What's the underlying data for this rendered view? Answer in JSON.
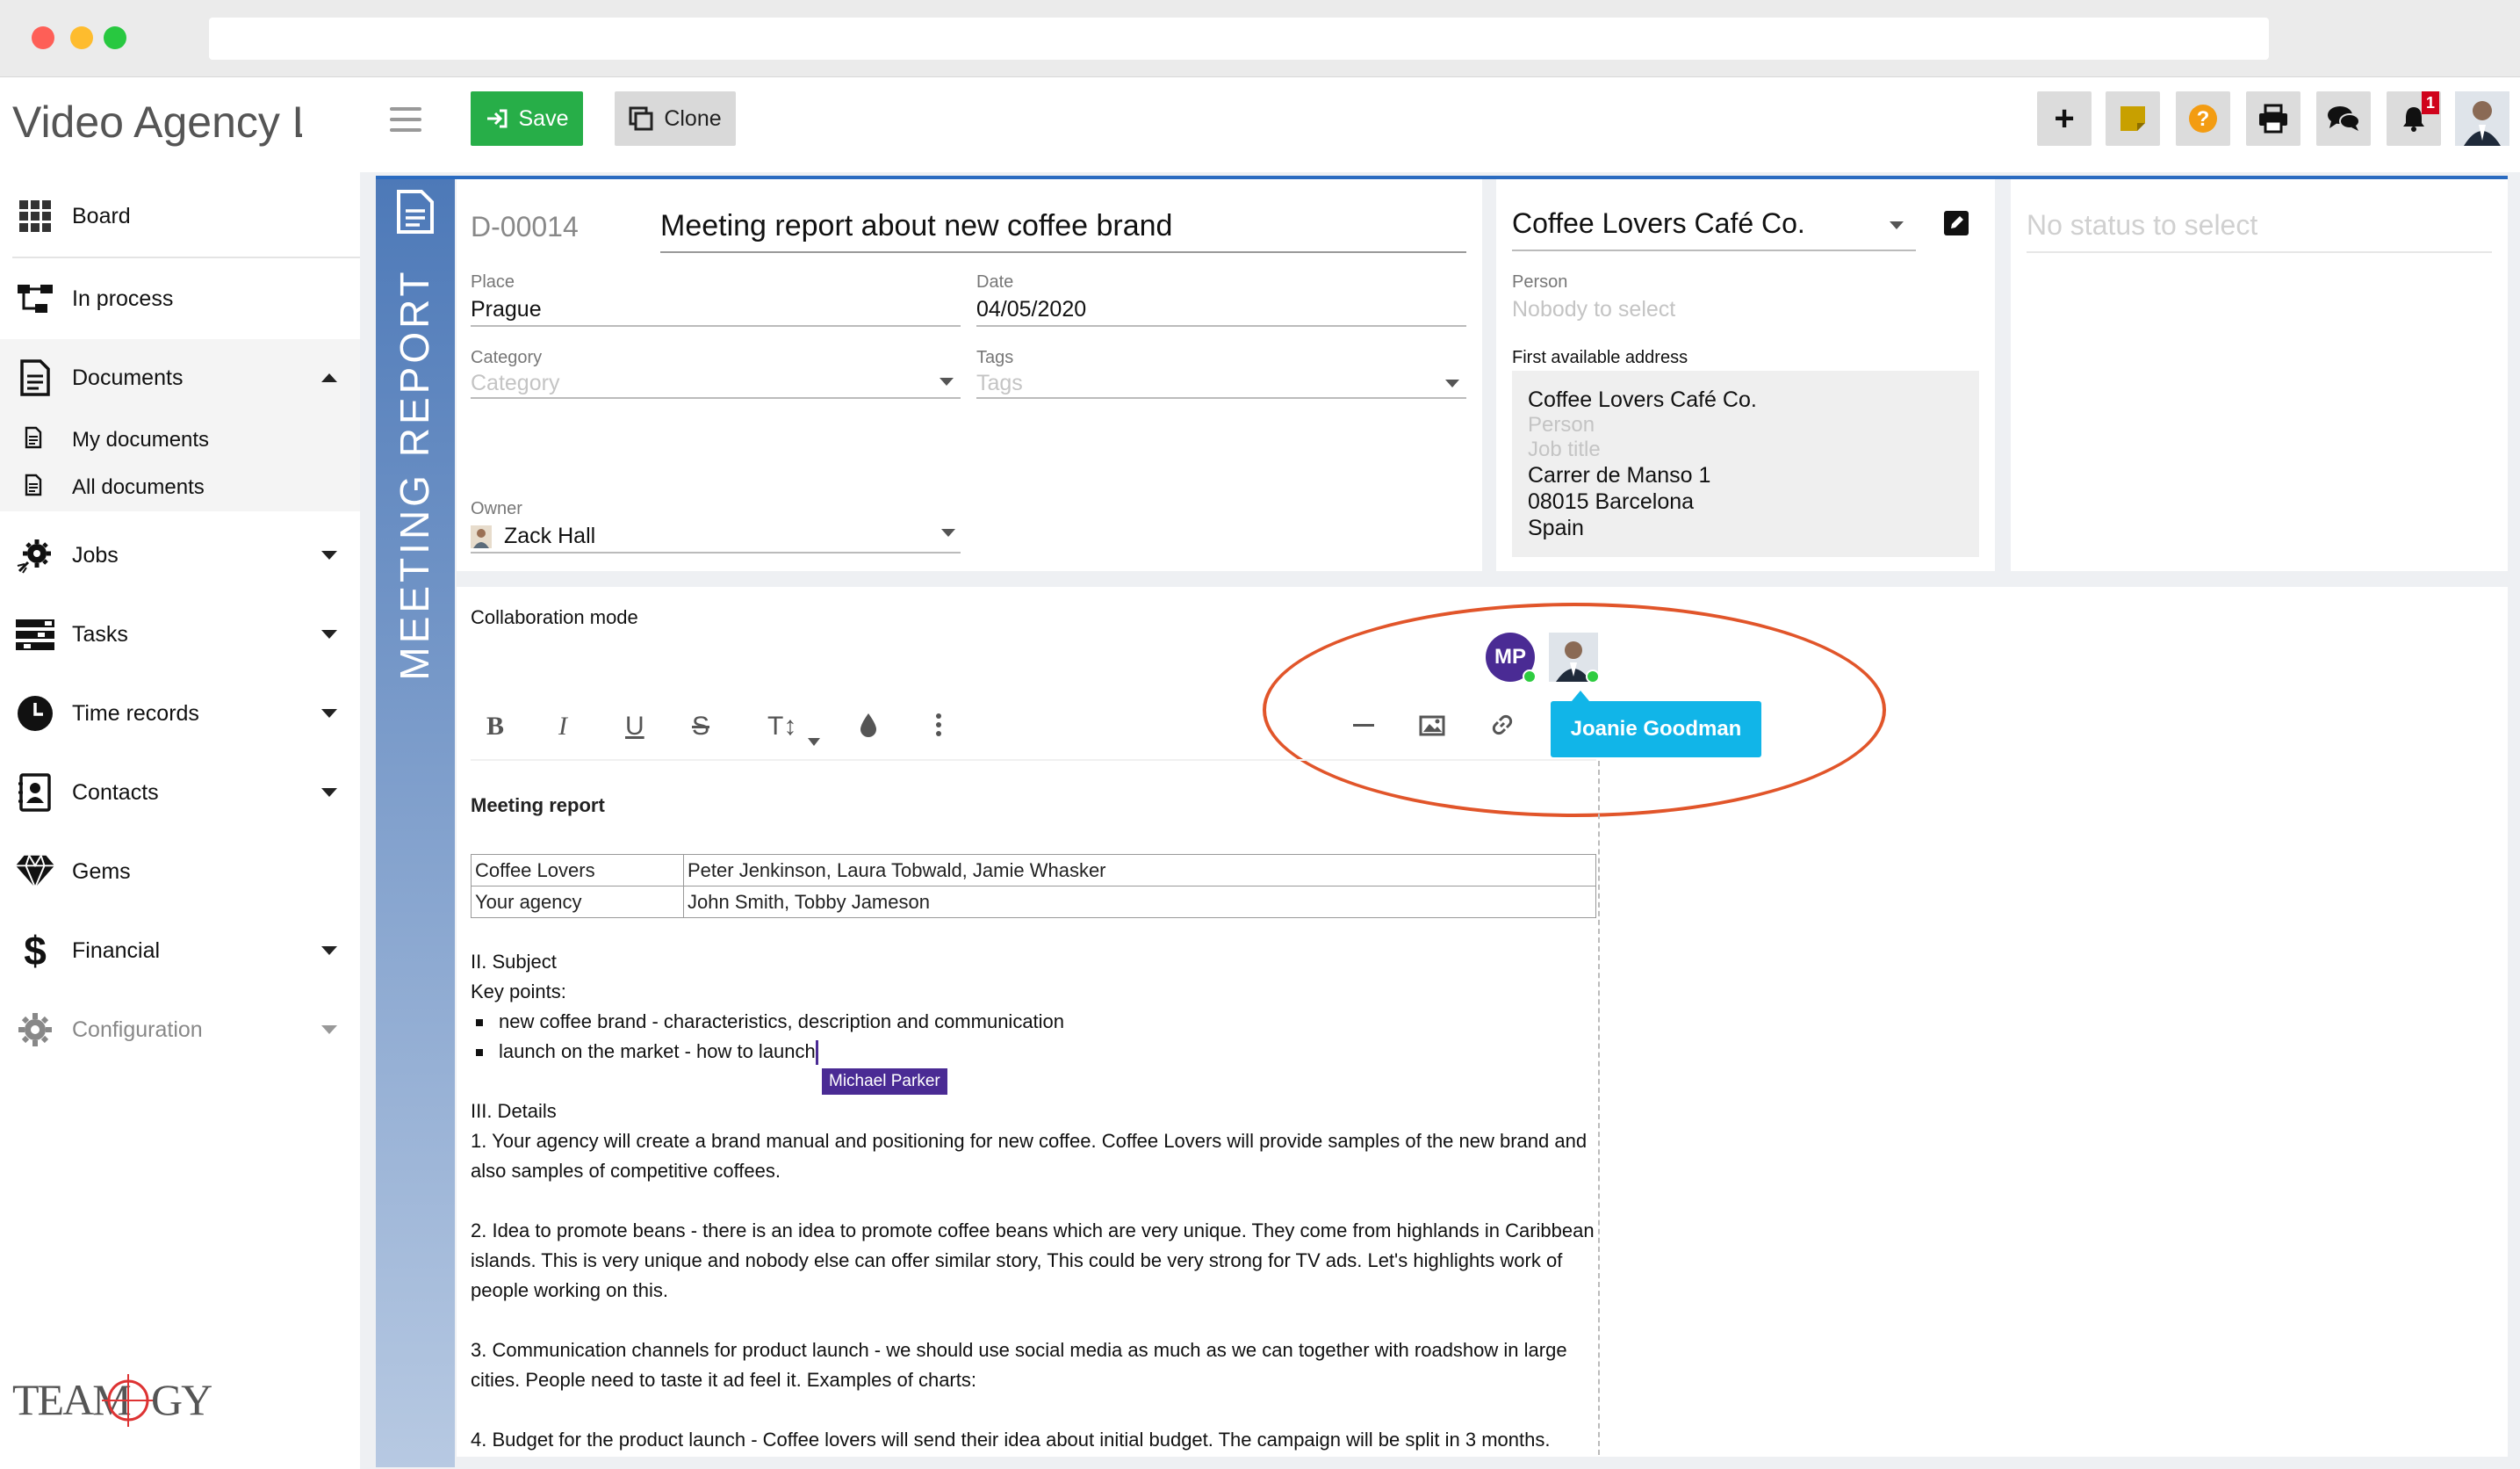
{
  "app": {
    "title": "Video Agency L"
  },
  "sidebar": {
    "items": [
      {
        "label": "Board",
        "icon": "grid-icon"
      },
      {
        "label": "In process",
        "icon": "workflow-icon"
      },
      {
        "label": "Documents",
        "icon": "document-icon",
        "expanded": true
      },
      {
        "label": "Jobs",
        "icon": "gear-rocket-icon"
      },
      {
        "label": "Tasks",
        "icon": "tasks-icon"
      },
      {
        "label": "Time records",
        "icon": "clock-icon"
      },
      {
        "label": "Contacts",
        "icon": "contact-card-icon"
      },
      {
        "label": "Gems",
        "icon": "gem-icon"
      },
      {
        "label": "Financial",
        "icon": "dollar-icon"
      },
      {
        "label": "Configuration",
        "icon": "gear-icon"
      }
    ],
    "sub_items": [
      {
        "label": "My documents"
      },
      {
        "label": "All documents"
      }
    ],
    "logo": "TEAMOGY"
  },
  "toolbar": {
    "save_label": "Save",
    "clone_label": "Clone",
    "notification_count": "1",
    "accent_save": "#27ae48"
  },
  "document": {
    "vertical_label": "MEETING REPORT",
    "number": "D-00014",
    "title": "Meeting report about new coffee brand",
    "place_label": "Place",
    "place_value": "Prague",
    "date_label": "Date",
    "date_value": "04/05/2020",
    "category_label": "Category",
    "category_placeholder": "Category",
    "tags_label": "Tags",
    "tags_placeholder": "Tags",
    "owner_label": "Owner",
    "owner_value": "Zack Hall"
  },
  "contact": {
    "company": "Coffee Lovers Café Co.",
    "person_label": "Person",
    "person_placeholder": "Nobody to select",
    "address_label": "First available address",
    "address_company": "Coffee Lovers Café Co.",
    "address_person": "Person",
    "address_job": "Job title",
    "address_street": "Carrer de Manso 1",
    "address_city": "08015 Barcelona",
    "address_country": "Spain"
  },
  "status": {
    "placeholder": "No status to select"
  },
  "editor": {
    "mode_label": "Collaboration mode",
    "collaborator_initials": "MP",
    "collaborator_tooltip": "Joanie Goodman",
    "cursor_user": "Michael Parker",
    "heading": "Meeting report",
    "table": [
      [
        "Coffee Lovers",
        "Peter Jenkinson, Laura Tobwald, Jamie Whasker"
      ],
      [
        "Your agency",
        "John Smith, Tobby Jameson"
      ]
    ],
    "subject_heading": "II. Subject",
    "key_points_label": "Key points:",
    "bullets": [
      "new coffee brand - characteristics, description and communication",
      "launch on the market - how to launch"
    ],
    "details_heading": "III. Details",
    "paragraphs": [
      "1. Your agency will create a brand manual and positioning for new coffee.  Coffee Lovers will provide samples of the new brand and also samples of competitive coffees.",
      "2. Idea to promote beans - there is an idea to promote coffee beans which are very unique. They come from highlands in Caribbean islands. This is very unique and nobody else can offer similar story, This could be very strong for TV ads. Let's highlights work of people working on this.",
      "3. Communication channels for product launch - we should use social media as much as we can together with roadshow in large cities. People need to taste it ad feel it. Examples of charts:",
      "4. Budget for the product launch - Coffee lovers will send their idea about initial budget. The campaign will be split in 3 months."
    ]
  }
}
